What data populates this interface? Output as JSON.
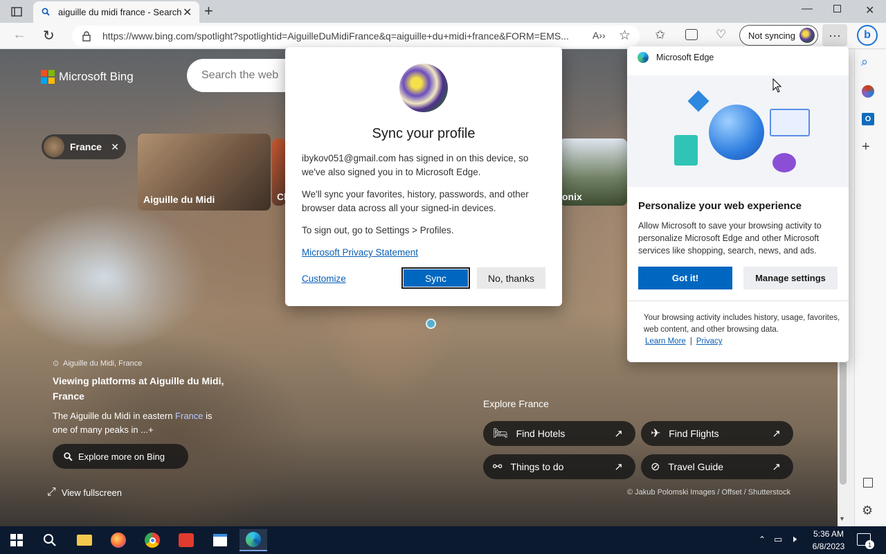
{
  "browser": {
    "tab_title": "aiguille du midi france - Search",
    "url": "https://www.bing.com/spotlight?spotlightid=AiguilleDuMidiFrance&q=aiguille+du+midi+france&FORM=EMS...",
    "sync_label": "Not syncing"
  },
  "bing": {
    "logo_text": "Microsoft Bing",
    "search_placeholder": "Search the web",
    "filter_chip": "France",
    "cards": [
      "Aiguille du Midi",
      "Cl",
      "onix"
    ],
    "location": "Aiguille du Midi, France",
    "headline": "Viewing platforms at Aiguille du Midi, France",
    "desc_pre": "The Aiguille du Midi in eastern ",
    "desc_link": "France",
    "desc_post": " is one of many peaks in ...+",
    "explore_btn": "Explore more on Bing",
    "fullscreen": "View fullscreen",
    "explore_title": "Explore France",
    "actions": [
      "Find Hotels",
      "Find Flights",
      "Things to do",
      "Travel Guide"
    ],
    "credit": "© Jakub Polomski Images / Offset / Shutterstock"
  },
  "sync_dialog": {
    "title": "Sync your profile",
    "p1": "ibykov051@gmail.com has signed in on this device, so we've also signed you in to Microsoft Edge.",
    "p2": "We'll sync your favorites, history, passwords, and other browser data across all your signed-in devices.",
    "p3": "To sign out, go to Settings > Profiles.",
    "privacy_link": "Microsoft Privacy Statement",
    "customize": "Customize",
    "sync_btn": "Sync",
    "no_btn": "No, thanks"
  },
  "flyout": {
    "brand": "Microsoft Edge",
    "title": "Personalize your web experience",
    "body": "Allow Microsoft to save your browsing activity to personalize Microsoft Edge and other Microsoft services like shopping, search, news, and ads.",
    "got_it": "Got it!",
    "manage": "Manage settings",
    "footer": "Your browsing activity includes history, usage, favorites, web content, and other browsing data.",
    "learn_more": "Learn More",
    "sep": "|",
    "privacy": "Privacy"
  },
  "taskbar": {
    "time": "5:36 AM",
    "date": "6/8/2023",
    "notif_count": "1"
  },
  "colors": {
    "accent": "#0067c0",
    "bing_blue": "#106ebe",
    "taskbar": "#0c1a30"
  }
}
